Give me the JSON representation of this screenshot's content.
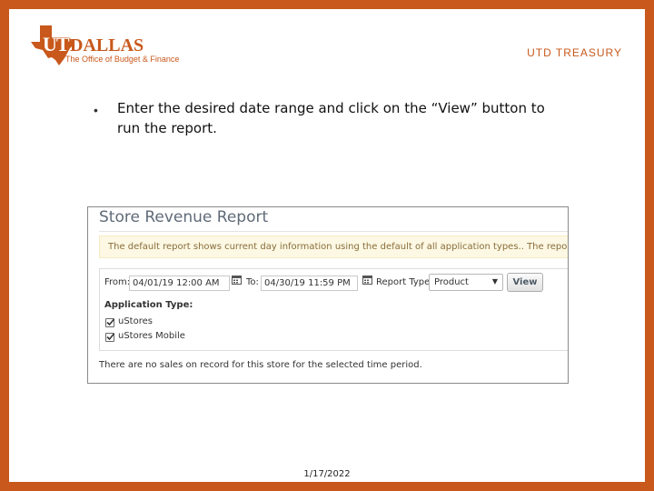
{
  "header": {
    "logo": {
      "brand_ut": "UT",
      "brand_dallas": "DALLAS",
      "subtitle": "The Office of Budget & Finance"
    },
    "label": "UTD TREASURY"
  },
  "content": {
    "bullet": "Enter the desired date range and click on the “View” button to run the report."
  },
  "report": {
    "title": "Store Revenue Report",
    "notice": "The default report shows current day information using the default of all application types.. The report is a summary",
    "from_label": "From:",
    "from_value": "04/01/19 12:00 AM",
    "to_label": "To:",
    "to_value": "04/30/19 11:59 PM",
    "report_type_label": "Report Type:",
    "report_type_value": "Product",
    "view_label": "View",
    "application_type_label": "Application Type:",
    "application_types": [
      {
        "label": "uStores",
        "checked": true
      },
      {
        "label": "uStores Mobile",
        "checked": true
      }
    ],
    "no_sales_message": "There are no sales on record for this store for the selected time period."
  },
  "footer": {
    "date": "1/17/2022"
  },
  "colors": {
    "frame": "#c8581b",
    "notice_bg": "#fcf8e3",
    "notice_text": "#8a6d3b",
    "title_text": "#5f6b78"
  },
  "icons": [
    "texas-star-icon",
    "calendar-icon",
    "checkbox-checked-icon",
    "dropdown-arrow-icon"
  ]
}
